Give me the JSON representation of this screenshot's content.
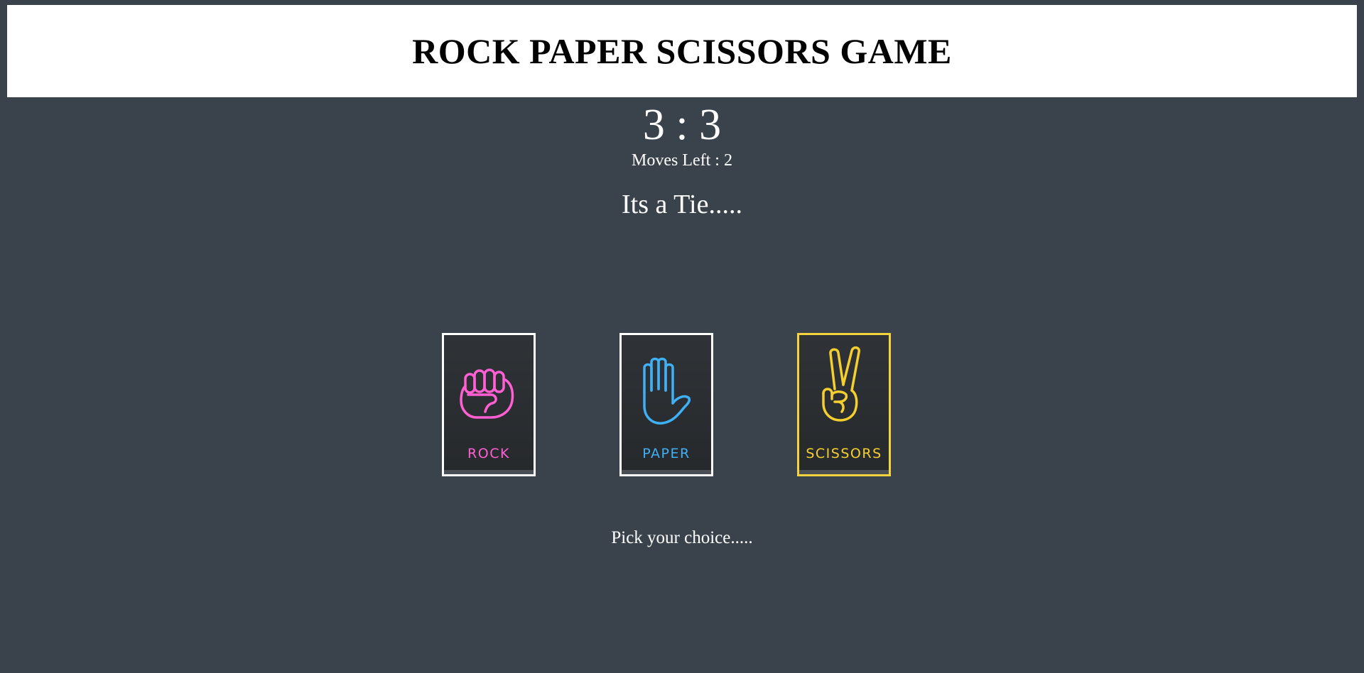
{
  "header": {
    "title": "ROCK PAPER SCISSORS GAME"
  },
  "scoreboard": {
    "score": "3 : 3",
    "moves_left": "Moves Left : 2"
  },
  "result": {
    "message": "Its a Tie....."
  },
  "choices": [
    {
      "label": "ROCK",
      "icon": "fist-icon",
      "color": "#ff5fd2",
      "selected": false
    },
    {
      "label": "PAPER",
      "icon": "open-hand-icon",
      "color": "#3fb0f5",
      "selected": false
    },
    {
      "label": "SCISSORS",
      "icon": "peace-hand-icon",
      "color": "#f5cf2f",
      "selected": true
    }
  ],
  "prompt": {
    "text": "Pick your choice....."
  },
  "colors": {
    "background": "#3a434c",
    "header_bg": "#ffffff",
    "selected_border": "#f5d33c",
    "card_border": "#ffffff"
  }
}
